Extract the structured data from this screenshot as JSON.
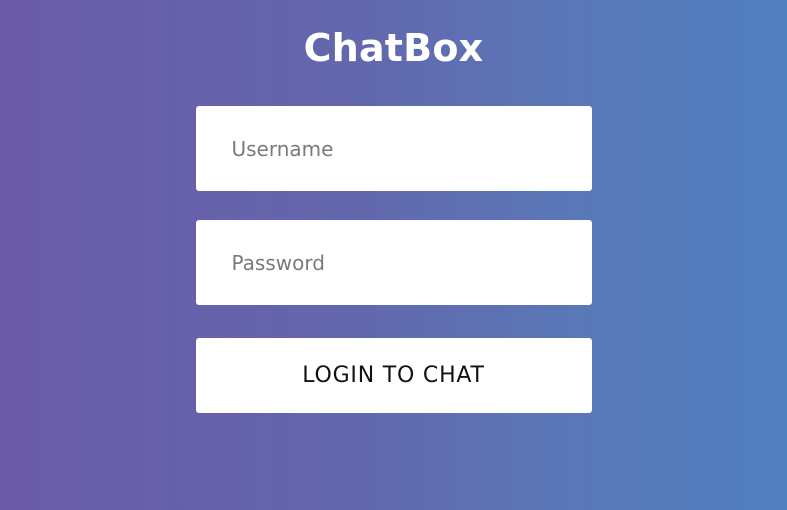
{
  "app": {
    "title": "ChatBox"
  },
  "login": {
    "username_placeholder": "Username",
    "username_value": "",
    "password_placeholder": "Password",
    "password_value": "",
    "submit_label": "LOGIN TO CHAT"
  },
  "colors": {
    "background_left": "#6a5aa7",
    "background_right": "#4f7fbf",
    "card_background": "#ffffff",
    "title_text": "#ffffff"
  }
}
